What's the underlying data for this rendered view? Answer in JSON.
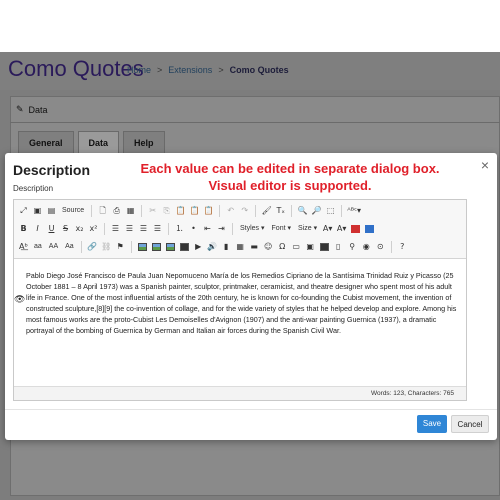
{
  "app": {
    "title": "Como Quotes",
    "breadcrumbs": [
      "Home",
      "Extensions",
      "Como Quotes"
    ],
    "breadcrumb_separator": ">"
  },
  "panel": {
    "title": "Data",
    "tabs": [
      "General",
      "Data",
      "Help"
    ],
    "active_tab": "Data"
  },
  "modal": {
    "title": "Description",
    "promo_line1": "Each value can be edited in separate dialog box.",
    "promo_line2": "Visual editor is supported.",
    "field_label": "Description",
    "close_symbol": "×",
    "save_label": "Save",
    "cancel_label": "Cancel"
  },
  "editor": {
    "toolbar": {
      "source_label": "Source",
      "styles_label": "Styles",
      "font_label": "Font",
      "size_label": "Size",
      "format_buttons": [
        "B",
        "I",
        "U",
        "S",
        "x₂",
        "x²"
      ],
      "case_buttons": [
        "aa",
        "AA",
        "Aa"
      ],
      "help_symbol": "?"
    },
    "content": "Pablo Diego José Francisco de Paula Juan Nepomuceno María de los Remedios Cipriano de la Santísima Trinidad Ruiz y Picasso (25 October 1881 – 8 April 1973) was a Spanish painter, sculptor, printmaker, ceramicist, and theatre designer who spent most of his adult life in France. One of the most influential artists of the 20th century, he is known for co-founding the Cubist movement, the invention of constructed sculpture,[8][9] the co-invention of collage, and for the wide variety of styles that he helped develop and explore. Among his most famous works are the proto-Cubist Les Demoiselles d'Avignon (1907) and the anti-war painting Guernica (1937), a dramatic portrayal of the bombing of Guernica by German and Italian air forces during the Spanish Civil War.",
    "status": "Words: 123, Characters: 765"
  },
  "colors": {
    "title_purple": "#2a1a5a",
    "promo_red": "#e0202a",
    "save_blue": "#2f86d6"
  }
}
